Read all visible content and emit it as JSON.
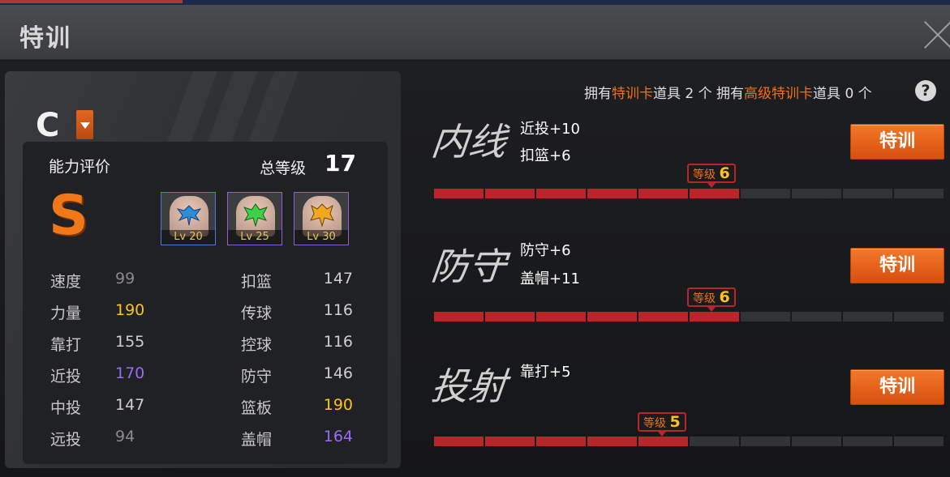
{
  "title": "特训",
  "header": {
    "close_icon": "close-icon"
  },
  "player": {
    "position": "C",
    "ability_label": "能力评价",
    "grade": "S",
    "total_level_label": "总等级",
    "total_level": "17",
    "tattoos": [
      {
        "level": "Lv 20",
        "color": "#4b7bd3"
      },
      {
        "level": "Lv 25",
        "color": "#9a5cd6"
      },
      {
        "level": "Lv 30",
        "color": "#9a5cd6"
      }
    ],
    "stats_left": [
      {
        "name": "速度",
        "value": "99",
        "color": "#8a8a8a"
      },
      {
        "name": "力量",
        "value": "190",
        "color": "#ffc21a"
      },
      {
        "name": "靠打",
        "value": "155",
        "color": "#cfcfcf"
      },
      {
        "name": "近投",
        "value": "170",
        "color": "#9a6cf0"
      },
      {
        "name": "中投",
        "value": "147",
        "color": "#cfcfcf"
      },
      {
        "name": "远投",
        "value": "94",
        "color": "#8a8a8a"
      }
    ],
    "stats_right": [
      {
        "name": "扣篮",
        "value": "147",
        "color": "#cfcfcf"
      },
      {
        "name": "传球",
        "value": "116",
        "color": "#cfcfcf"
      },
      {
        "name": "控球",
        "value": "116",
        "color": "#cfcfcf"
      },
      {
        "name": "防守",
        "value": "146",
        "color": "#cfcfcf"
      },
      {
        "name": "篮板",
        "value": "190",
        "color": "#ffc21a"
      },
      {
        "name": "盖帽",
        "value": "164",
        "color": "#9a6cf0"
      }
    ]
  },
  "owned": {
    "p1": "拥有",
    "card1": "特训卡",
    "p2": "道具",
    "count1": "2",
    "unit1": "个",
    "p3": "拥有",
    "card2": "高级特训卡",
    "p4": "道具",
    "count2": "0",
    "unit2": "个",
    "help": "?"
  },
  "trainings": [
    {
      "name": "内线",
      "bonuses": [
        "近投+10",
        "扣篮+6"
      ],
      "level_label": "等级",
      "level": "6",
      "max_level": 10,
      "button": "特训"
    },
    {
      "name": "防守",
      "bonuses": [
        "防守+6",
        "盖帽+11"
      ],
      "level_label": "等级",
      "level": "6",
      "max_level": 10,
      "button": "特训"
    },
    {
      "name": "投射",
      "bonuses": [
        "靠打+5"
      ],
      "level_label": "等级",
      "level": "5",
      "max_level": 10,
      "button": "特训"
    }
  ]
}
